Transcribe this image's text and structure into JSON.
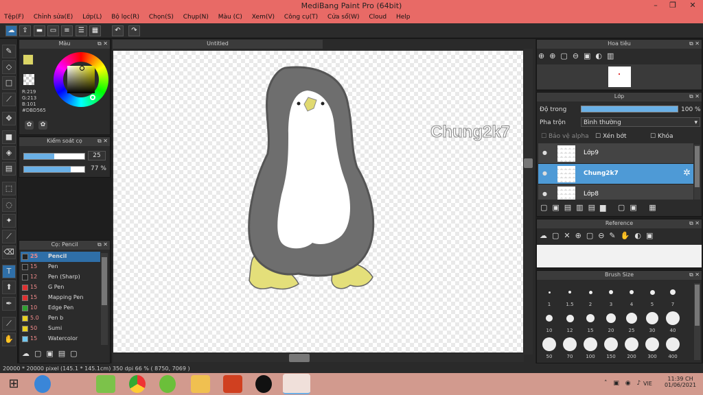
{
  "window": {
    "title": "MediBang Paint Pro (64bit)"
  },
  "menu": [
    "Tệp(F)",
    "Chỉnh sửa(E)",
    "Lớp(L)",
    "Bộ lọc(R)",
    "Chọn(S)",
    "Chụp(N)",
    "Màu (C)",
    "Xem(V)",
    "Công cụ(T)",
    "Cửa sổ(W)",
    "Cloud",
    "Help"
  ],
  "canvas": {
    "tab_title": "Untitled",
    "watermark": "Chung2k7"
  },
  "color_panel": {
    "title": "Màu",
    "r": "R:219",
    "g": "G:213",
    "b": "B:101",
    "hex": "#DBD565",
    "fg_color": "#dbd565"
  },
  "brush_control": {
    "title": "Kiểm soát cọ",
    "size_value": "25",
    "size_fill": 0.5,
    "opacity_value": "77 %",
    "opacity_fill": 0.77
  },
  "brush_panel": {
    "title": "Cọ: Pencil",
    "brushes": [
      {
        "size": "25",
        "name": "Pencil",
        "color": "#222222",
        "selected": true
      },
      {
        "size": "15",
        "name": "Pen",
        "color": "#222222"
      },
      {
        "size": "12",
        "name": "Pen (Sharp)",
        "color": "#222222"
      },
      {
        "size": "15",
        "name": "G Pen",
        "color": "#e03030"
      },
      {
        "size": "15",
        "name": "Mapping Pen",
        "color": "#e03030"
      },
      {
        "size": "10",
        "name": "Edge Pen",
        "color": "#30a030"
      },
      {
        "size": "5.0",
        "name": "Pen b",
        "color": "#e8d020"
      },
      {
        "size": "50",
        "name": "Sumi",
        "color": "#e8d020"
      },
      {
        "size": "15",
        "name": "Watercolor",
        "color": "#70c8f0"
      }
    ]
  },
  "navigator": {
    "title": "Hoa tiêu"
  },
  "layer_panel": {
    "title": "Lớp",
    "opacity_label": "Độ trong",
    "opacity_value": "100 %",
    "opacity_fill": 1,
    "blend_label": "Pha trộn",
    "blend_value": "Bình thường",
    "protect_alpha": "Bảo vệ alpha",
    "clipping": "Xén bớt",
    "lock": "Khóa",
    "layers": [
      {
        "name": "Lớp9",
        "selected": false
      },
      {
        "name": "Chung2k7",
        "selected": true
      },
      {
        "name": "Lớp8",
        "selected": false
      }
    ]
  },
  "reference_panel": {
    "title": "Reference"
  },
  "brush_size_panel": {
    "title": "Brush Size",
    "sizes": [
      "1",
      "1.5",
      "2",
      "3",
      "4",
      "5",
      "7",
      "10",
      "12",
      "15",
      "20",
      "25",
      "30",
      "40",
      "50",
      "70",
      "100",
      "150",
      "200",
      "300",
      "400"
    ]
  },
  "status": {
    "text": "20000 * 20000 pixel   (145.1 * 145.1cm)   350 dpi   66 %   ( 8750, 7069 )"
  },
  "taskbar": {
    "lang": "VIE",
    "time": "11:39 CH",
    "date": "01/06/2021"
  }
}
